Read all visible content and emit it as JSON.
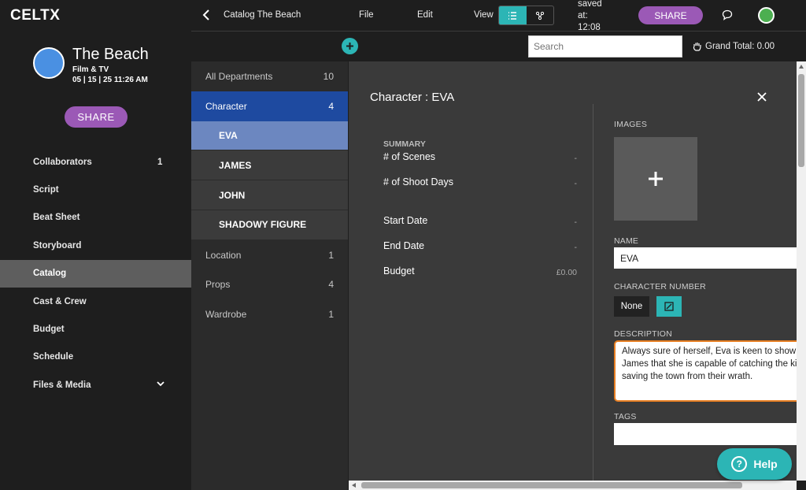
{
  "app": {
    "logo": "CELTX"
  },
  "project": {
    "title": "The Beach",
    "type": "Film & TV",
    "date": "05 | 15 | 25 11:26 AM",
    "share_label": "SHARE"
  },
  "sidebar": {
    "items": [
      {
        "label": "Collaborators",
        "count": "1"
      },
      {
        "label": "Script",
        "count": ""
      },
      {
        "label": "Beat Sheet",
        "count": ""
      },
      {
        "label": "Storyboard",
        "count": ""
      },
      {
        "label": "Catalog",
        "count": "",
        "active": true
      },
      {
        "label": "Cast & Crew",
        "count": ""
      },
      {
        "label": "Budget",
        "count": ""
      },
      {
        "label": "Schedule",
        "count": ""
      },
      {
        "label": "Files & Media",
        "count": ""
      }
    ]
  },
  "topbar": {
    "title": "Catalog The Beach",
    "file": "File",
    "edit": "Edit",
    "view": "View",
    "saved_line1": "saved",
    "saved_line2": "at:",
    "saved_line3": "12:08",
    "share_label": "SHARE"
  },
  "subbar": {
    "search_placeholder": "Search",
    "grand_total": "Grand Total: 0.00"
  },
  "departments": [
    {
      "label": "All Departments",
      "count": "10"
    },
    {
      "label": "Character",
      "count": "4",
      "selected": true
    },
    {
      "label": "EVA",
      "sub": true,
      "selected": true
    },
    {
      "label": "JAMES",
      "sub": true
    },
    {
      "label": "JOHN",
      "sub": true
    },
    {
      "label": "SHADOWY FIGURE",
      "sub": true
    },
    {
      "label": "Location",
      "count": "1"
    },
    {
      "label": "Props",
      "count": "4"
    },
    {
      "label": "Wardrobe",
      "count": "1"
    }
  ],
  "detail": {
    "title": "Character : EVA",
    "summary_heading": "SUMMARY",
    "rows": [
      {
        "label": "# of Scenes",
        "value": "-"
      },
      {
        "label": "# of Shoot Days",
        "value": "-"
      },
      {
        "label": "Start Date",
        "value": "-"
      },
      {
        "label": "End Date",
        "value": "-"
      },
      {
        "label": "Budget",
        "value": "£0.00"
      }
    ],
    "images_label": "IMAGES",
    "name_label": "NAME",
    "name_value": "EVA",
    "char_number_label": "CHARACTER NUMBER",
    "char_number_value": "None",
    "description_label": "DESCRIPTION",
    "description_text": "Always sure of herself, Eva is keen to show h\nJames that she is capable of catching the kil\nsaving the town from their wrath.",
    "tags_label": "TAGS",
    "tags_value": ""
  },
  "help": {
    "label": "Help"
  },
  "colors": {
    "accent": "#2cb5b5",
    "brand": "#9b59b6",
    "selected": "#1e4aa0",
    "focus": "#e67e22"
  }
}
